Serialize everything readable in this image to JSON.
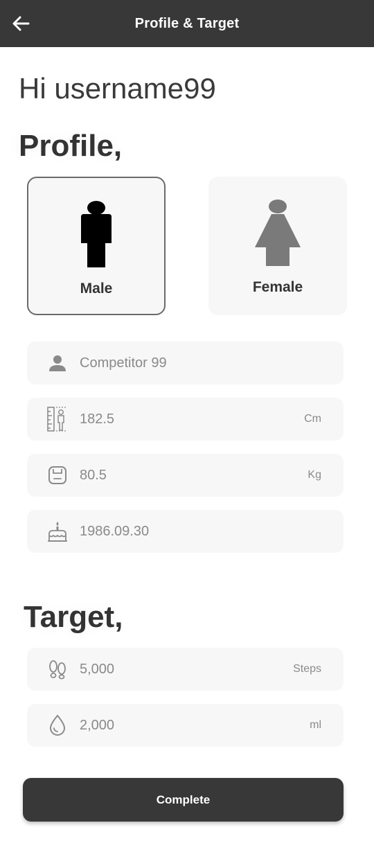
{
  "header": {
    "title": "Profile & Target"
  },
  "greeting": "Hi username99",
  "profile": {
    "section_title": "Profile,",
    "gender": {
      "selected": "male",
      "male_label": "Male",
      "female_label": "Female"
    },
    "name": {
      "value": "Competitor 99",
      "icon": "person-icon"
    },
    "height": {
      "value": "182.5",
      "unit": "Cm",
      "icon": "height-ruler-icon"
    },
    "weight": {
      "value": "80.5",
      "unit": "Kg",
      "icon": "scale-icon"
    },
    "birthdate": {
      "value": "1986.09.30",
      "icon": "cake-icon"
    }
  },
  "target": {
    "section_title": "Target,",
    "steps": {
      "value": "5,000",
      "unit": "Steps",
      "icon": "footsteps-icon"
    },
    "water": {
      "value": "2,000",
      "unit": "ml",
      "icon": "water-drop-icon"
    }
  },
  "complete_label": "Complete",
  "colors": {
    "header_bg": "#383838",
    "field_bg": "#f7f7f7",
    "text_dark": "#333333",
    "text_muted": "#8a8a8a",
    "icon_grey": "#8a8a8a",
    "female_icon": "#7a7a7a"
  }
}
